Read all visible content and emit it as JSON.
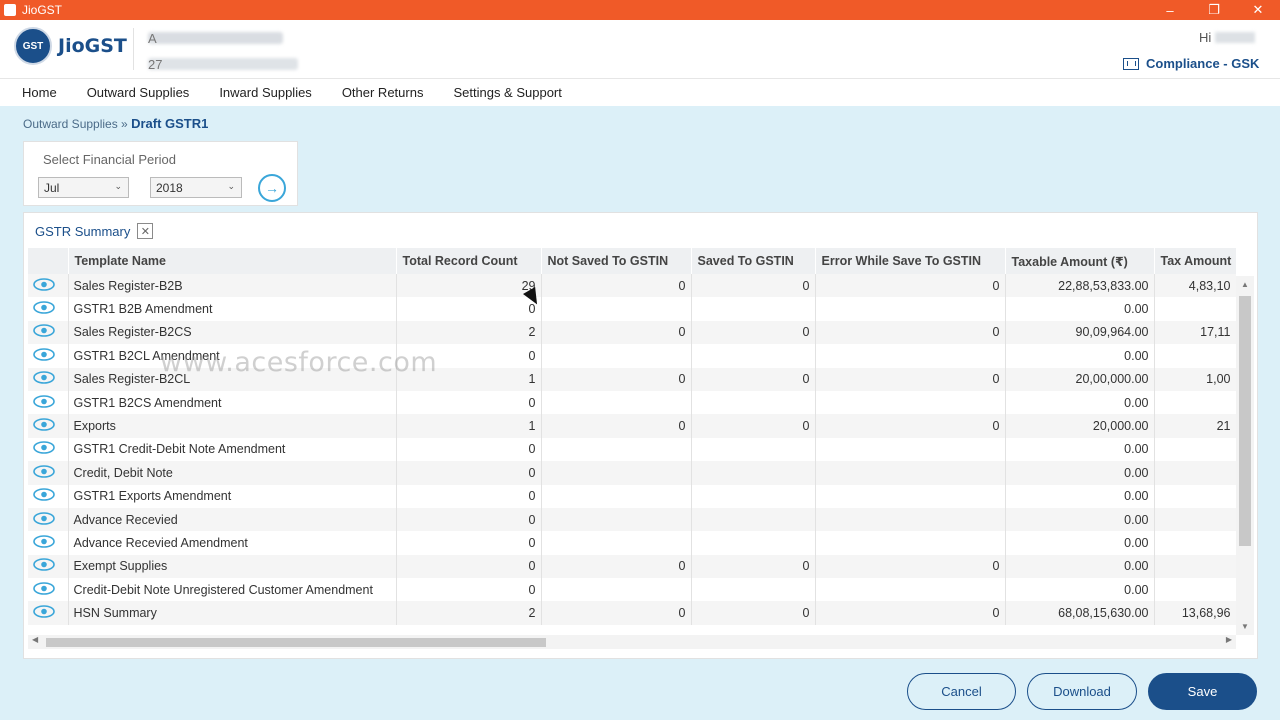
{
  "window": {
    "title": "JioGST",
    "controls": [
      "–",
      "❐",
      "✕"
    ]
  },
  "header": {
    "logo_badge": "GST",
    "logo_text": "JioGST",
    "company_initial": "A",
    "company_id_prefix": "27",
    "greeting": "Hi",
    "compliance_label": "Compliance - GSK"
  },
  "nav": [
    "Home",
    "Outward Supplies",
    "Inward Supplies",
    "Other Returns",
    "Settings & Support"
  ],
  "breadcrumb": {
    "parent": "Outward Supplies",
    "sep": " » ",
    "current": "Draft GSTR1"
  },
  "period": {
    "label": "Select Financial Period",
    "month": "Jul",
    "year": "2018",
    "go_icon": "→"
  },
  "summary": {
    "title": "GSTR Summary",
    "close_glyph": "✕",
    "columns": [
      "Template Name",
      "Total Record Count",
      "Not Saved To GSTIN",
      "Saved To GSTIN",
      "Error While Save To GSTIN",
      "Taxable Amount (₹)",
      "Tax Amount"
    ],
    "rows": [
      [
        "Sales Register-B2B",
        "29",
        "0",
        "0",
        "0",
        "22,88,53,833.00",
        "4,83,10"
      ],
      [
        "GSTR1 B2B Amendment",
        "0",
        "",
        "",
        "",
        "0.00",
        ""
      ],
      [
        "Sales Register-B2CS",
        "2",
        "0",
        "0",
        "0",
        "90,09,964.00",
        "17,11"
      ],
      [
        "GSTR1 B2CL Amendment",
        "0",
        "",
        "",
        "",
        "0.00",
        ""
      ],
      [
        "Sales Register-B2CL",
        "1",
        "0",
        "0",
        "0",
        "20,00,000.00",
        "1,00"
      ],
      [
        "GSTR1 B2CS Amendment",
        "0",
        "",
        "",
        "",
        "0.00",
        ""
      ],
      [
        "Exports",
        "1",
        "0",
        "0",
        "0",
        "20,000.00",
        "21"
      ],
      [
        "GSTR1 Credit-Debit Note Amendment",
        "0",
        "",
        "",
        "",
        "0.00",
        ""
      ],
      [
        "Credit, Debit Note",
        "0",
        "",
        "",
        "",
        "0.00",
        ""
      ],
      [
        "GSTR1 Exports Amendment",
        "0",
        "",
        "",
        "",
        "0.00",
        ""
      ],
      [
        "Advance Recevied",
        "0",
        "",
        "",
        "",
        "0.00",
        ""
      ],
      [
        "Advance Recevied Amendment",
        "0",
        "",
        "",
        "",
        "0.00",
        ""
      ],
      [
        "Exempt Supplies",
        "0",
        "0",
        "0",
        "0",
        "0.00",
        ""
      ],
      [
        "Credit-Debit Note Unregistered Customer Amendment",
        "0",
        "",
        "",
        "",
        "0.00",
        ""
      ],
      [
        "HSN Summary",
        "2",
        "0",
        "0",
        "0",
        "68,08,15,630.00",
        "13,68,96"
      ]
    ]
  },
  "watermark": "www.acesforce.com",
  "buttons": {
    "cancel": "Cancel",
    "download": "Download",
    "save": "Save"
  },
  "colors": {
    "accent": "#1b4f8a",
    "titlebar": "#f05a28",
    "background": "#dcf0f8",
    "eye": "#3aa6d9"
  }
}
